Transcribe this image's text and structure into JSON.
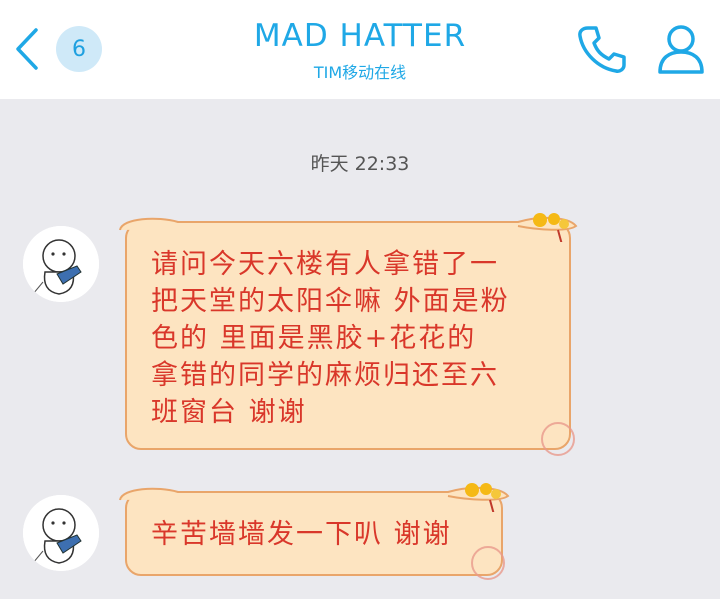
{
  "header": {
    "unread_badge": "6",
    "contact_name": "MAD HATTER",
    "status": "TIM移动在线"
  },
  "timestamp": "昨天 22:33",
  "messages": [
    {
      "lines": [
        "请问今天六楼有人拿错了一",
        "把天堂的太阳伞嘛 外面是粉",
        "色的 里面是黑胶+花花的",
        "拿错的同学的麻烦归还至六",
        "班窗台 谢谢"
      ]
    },
    {
      "lines": [
        "辛苦墙墙发一下叭 谢谢"
      ]
    }
  ],
  "colors": {
    "accent": "#1fa8e6",
    "bubble_fill": "#fde4c1",
    "bubble_border": "#e9a56a",
    "bubble_text": "#d9372a"
  },
  "icons": {
    "back": "chevron-left-icon",
    "phone": "phone-icon",
    "profile": "person-icon"
  }
}
